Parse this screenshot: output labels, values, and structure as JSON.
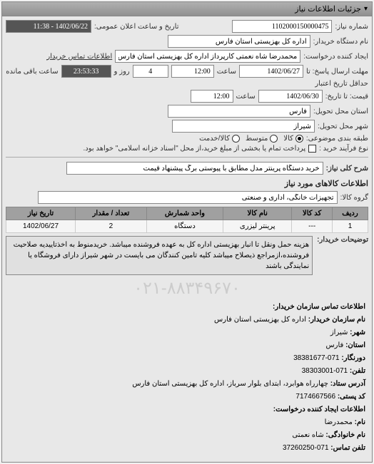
{
  "panel_title": "جزئیات اطلاعات نیاز",
  "header": {
    "request_number_label": "شماره نیاز:",
    "request_number": "1102000150000475",
    "announce_label": "تاریخ و ساعت اعلان عمومی:",
    "announce_value": "1402/06/22 - 11:38"
  },
  "org": {
    "device_name_label": "نام دستگاه خریدار:",
    "device_name": "اداره کل بهزیستی استان فارس",
    "creator_label": "ایجاد کننده درخواست:",
    "creator_value": "محمدرضا شاه نعمتی کارپرداز اداره کل بهزیستی استان فارس",
    "buyer_contact_label": "اطلاعات تماس خریدار"
  },
  "deadlines": {
    "response_label": "مهلت ارسال پاسخ: تا",
    "response_date": "1402/06/27",
    "time_label": "ساعت",
    "response_time": "12:00",
    "days_value": "4",
    "days_label": "روز و",
    "remaining_time": "23:53:33",
    "remaining_label": "ساعت باقی مانده",
    "validity_label": "حداقل تاریخ اعتبار",
    "price_label": "قیمت: تا تاریخ:",
    "validity_date": "1402/06/30",
    "validity_time": "12:00"
  },
  "location": {
    "delivery_province_label": "استان محل تحویل:",
    "delivery_province": "فارس",
    "delivery_city_label": "شهر محل تحویل:",
    "delivery_city": "شیراز"
  },
  "category": {
    "label": "طبقه بندی موضوعی:",
    "opt_goods": "کالا",
    "opt_medium": "متوسط",
    "opt_service": "کالا/خدمت"
  },
  "purchase_type": {
    "label": "نوع فرآیند خرید :",
    "checkbox_text": "پرداخت تمام یا بخشی از مبلغ خرید،از محل \"اسناد خزانه اسلامی\" خواهد بود."
  },
  "summary": {
    "label": "شرح کلی نیاز:",
    "value": "خرید دستگاه پرینتر مدل مطابق با پیوستی برگ پیشنهاد قیمت"
  },
  "items_section_title": "اطلاعات کالاهای مورد نیاز",
  "group": {
    "label": "گروه کالا:",
    "value": "تجهیزات خانگی، اداری و صنعتی"
  },
  "table": {
    "headers": {
      "row": "ردیف",
      "code": "کد کالا",
      "name": "نام کالا",
      "unit": "واحد شمارش",
      "qty": "تعداد / مقدار",
      "date": "تاریخ نیاز"
    },
    "rows": [
      {
        "row": "1",
        "code": "---",
        "name": "پرینتر لیزری",
        "unit": "دستگاه",
        "qty": "2",
        "date": "1402/06/27"
      }
    ]
  },
  "notes": {
    "label": "توضیحات خریدار:",
    "text": "هزینه حمل ونقل تا انبار بهزیستی اداره کل به عهده فروشنده میباشد. خریدمنوط به اخذتاییدیه صلاحیت فروشنده،ازمراجع ذیصلاح میباشد کلیه تامین کنندگان می بایست در شهر شیراز دارای فروشگاه یا نمایندگی باشند"
  },
  "watermark": "۰۲۱-۸۸۳۴۹۶۷۰",
  "contact": {
    "title": "اطلاعات تماس سازمان خریدار:",
    "buyer_name_label": "نام سازمان خریدار:",
    "buyer_name": "اداره کل بهزیستی استان فارس",
    "city_label": "شهر:",
    "city": "شیراز",
    "province_label": "استان:",
    "province": "فارس",
    "fax_label": "دورنگار:",
    "fax": "071-38381677",
    "phone_label": "تلفن:",
    "phone": "071-38303001",
    "address_label": "آدرس ستاد:",
    "address": "چهارراه هوابرد، ابتدای بلوار سرباز، اداره کل بهزیستی استان فارس",
    "postal_label": "کد پستی:",
    "postal": "7174667566",
    "creator_info_label": "اطلاعات ایجاد کننده درخواست:",
    "name_label": "نام:",
    "name_value": "محمدرضا",
    "family_label": "نام خانوادگی:",
    "family_value": "شاه نعمتی",
    "contact_phone_label": "تلفن تماس:",
    "contact_phone": "071-37260250"
  }
}
